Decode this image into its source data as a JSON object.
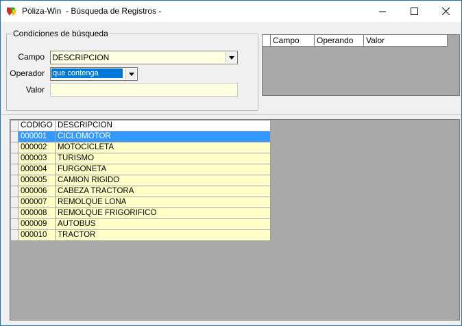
{
  "window": {
    "title": "Póliza-Win  - Búsqueda de Registros -"
  },
  "search": {
    "group_title": "Condiciones de búsqueda",
    "campo_label": "Campo",
    "campo_value": "DESCRIPCION",
    "operador_label": "Operador",
    "operador_value": "que contenga",
    "valor_label": "Valor",
    "valor_value": ""
  },
  "criteria": {
    "columns": [
      "Campo",
      "Operando",
      "Valor"
    ]
  },
  "results": {
    "columns": [
      "CODIGO",
      "DESCRIPCION"
    ],
    "rows": [
      {
        "codigo": "000001",
        "descripcion": "CICLOMOTOR"
      },
      {
        "codigo": "000002",
        "descripcion": "MOTOCICLETA"
      },
      {
        "codigo": "000003",
        "descripcion": "TURISMO"
      },
      {
        "codigo": "000004",
        "descripcion": "FURGONETA"
      },
      {
        "codigo": "000005",
        "descripcion": "CAMION RIGIDO"
      },
      {
        "codigo": "000006",
        "descripcion": "CABEZA TRACTORA"
      },
      {
        "codigo": "000007",
        "descripcion": "REMOLQUE LONA"
      },
      {
        "codigo": "000008",
        "descripcion": "REMOLQUE FRIGORIFICO"
      },
      {
        "codigo": "000009",
        "descripcion": "AUTOBUS"
      },
      {
        "codigo": "000010",
        "descripcion": "TRACTOR"
      }
    ],
    "selected_index": 0
  },
  "colors": {
    "input_bg": "#ffffe1",
    "row_bg": "#ffffc8",
    "selection": "#3399ff",
    "panel_gray": "#a9a9a9",
    "window_border": "#1a73c8"
  }
}
